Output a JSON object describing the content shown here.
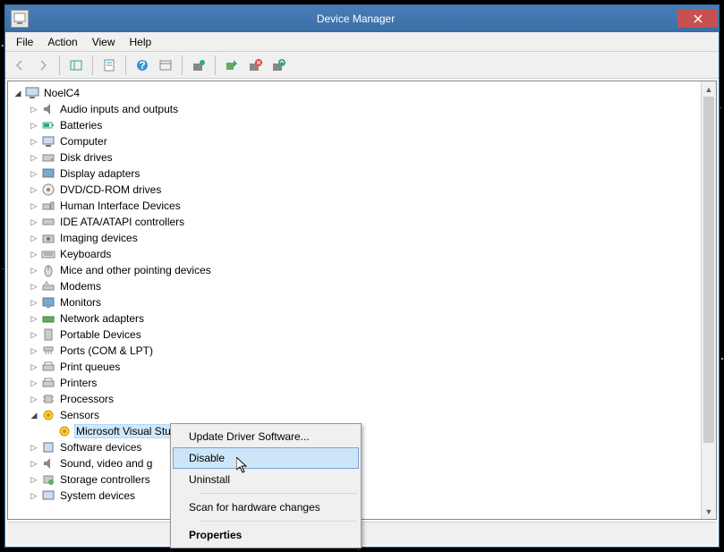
{
  "window": {
    "title": "Device Manager"
  },
  "menubar": [
    "File",
    "Action",
    "View",
    "Help"
  ],
  "tree": {
    "root": "NoelC4",
    "categories": [
      "Audio inputs and outputs",
      "Batteries",
      "Computer",
      "Disk drives",
      "Display adapters",
      "DVD/CD-ROM drives",
      "Human Interface Devices",
      "IDE ATA/ATAPI controllers",
      "Imaging devices",
      "Keyboards",
      "Mice and other pointing devices",
      "Modems",
      "Monitors",
      "Network adapters",
      "Portable Devices",
      "Ports (COM & LPT)",
      "Print queues",
      "Printers",
      "Processors",
      "Sensors",
      "Software devices",
      "Sound, video and g",
      "Storage controllers",
      "System devices"
    ],
    "sensors_child": "Microsoft Visual Studio Location Simulator Sensor"
  },
  "context_menu": {
    "update": "Update Driver Software...",
    "disable": "Disable",
    "uninstall": "Uninstall",
    "scan": "Scan for hardware changes",
    "properties": "Properties"
  }
}
